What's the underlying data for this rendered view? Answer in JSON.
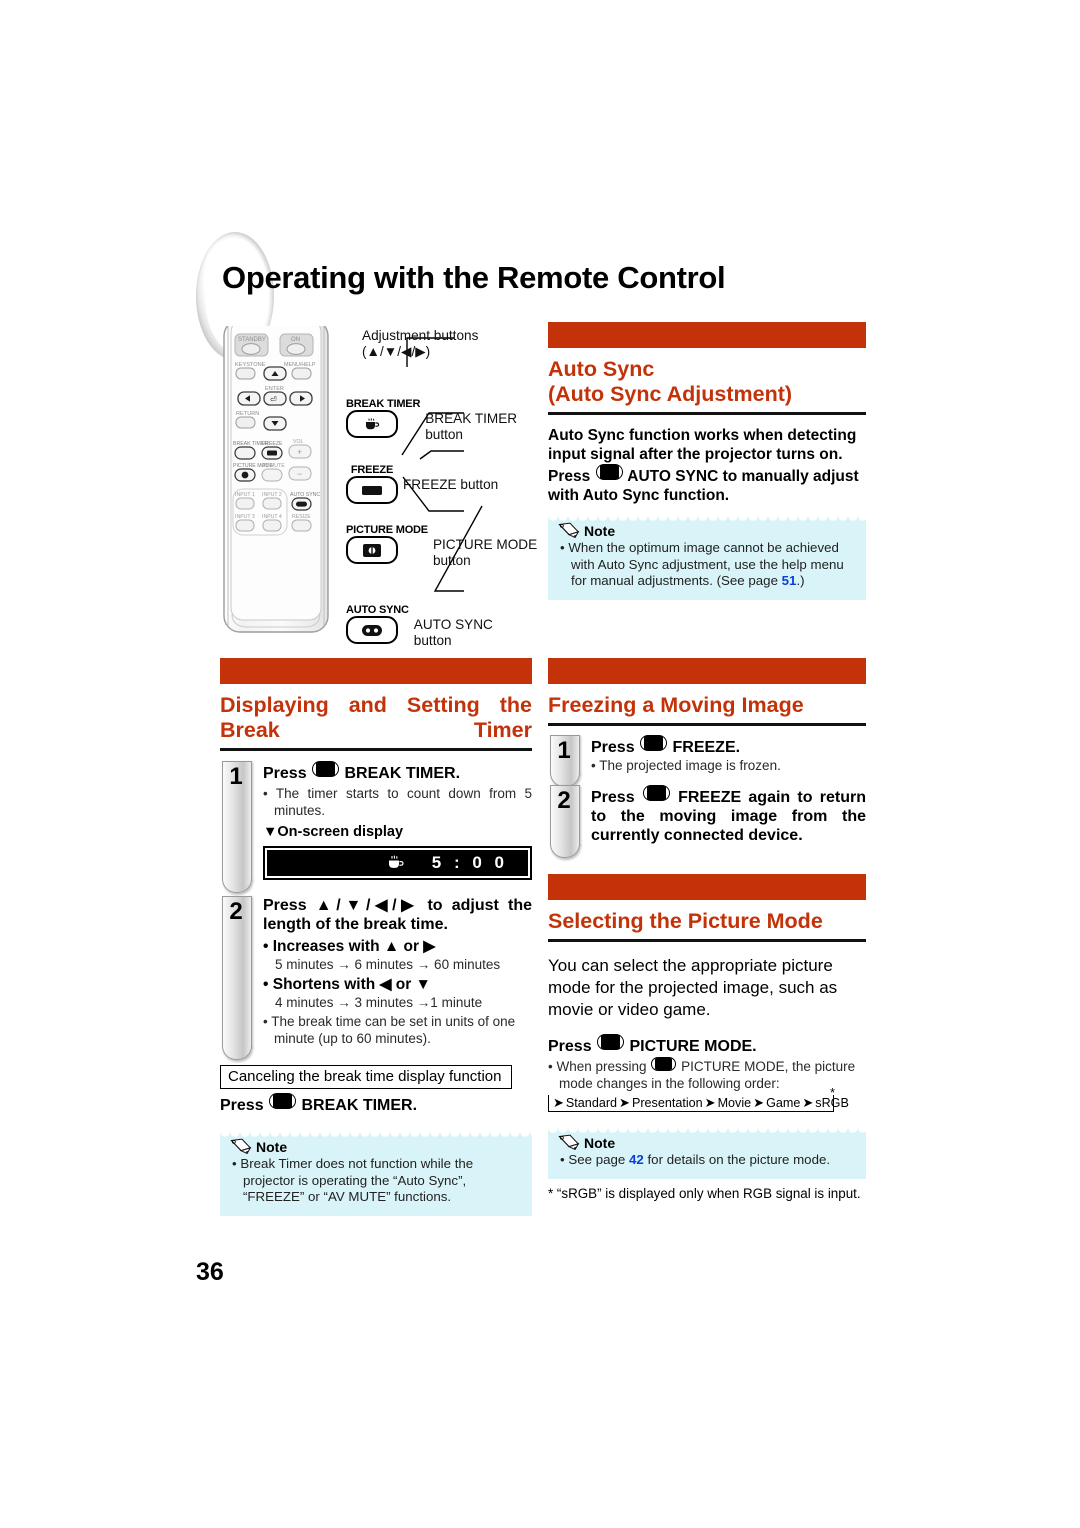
{
  "page": {
    "title": "Operating with the Remote Control",
    "number": "36"
  },
  "remote_diagram": {
    "callouts": [
      {
        "label": "Adjustment buttons",
        "label2": "(▲/▼/◀/▶)"
      },
      {
        "key_name": "BREAK TIMER",
        "label": "BREAK TIMER",
        "label2": "button"
      },
      {
        "key_name": "FREEZE",
        "label": "FREEZE button",
        "label2": ""
      },
      {
        "key_name": "PICTURE MODE",
        "label": "PICTURE MODE",
        "label2": "button"
      },
      {
        "key_name": "AUTO SYNC",
        "label": "AUTO SYNC",
        "label2": "button"
      }
    ],
    "remote_keys": [
      "STANDBY",
      "ON",
      "KEYSTONE",
      "MENU/HELP",
      "ENTER",
      "RETURN",
      "BREAK TIMER",
      "FREEZE",
      "VOL",
      "PICTURE MODE",
      "AV MUTE",
      "INPUT 1",
      "INPUT 2",
      "AUTO SYNC",
      "INPUT 3",
      "INPUT 4",
      "RESIZE"
    ]
  },
  "sections": {
    "auto_sync": {
      "heading_line1": "Auto Sync",
      "heading_line2": "(Auto Sync Adjustment)",
      "body": "Auto Sync function works when detecting input signal after the projector turns on.",
      "body2_pre": "Press",
      "body2_post": "AUTO SYNC to manually adjust with Auto Sync function.",
      "note_title": "Note",
      "note_items": [
        {
          "text_before": "When the optimum image cannot be achieved with Auto Sync adjustment, use the help menu for manual adjustments. (See page ",
          "page_ref": "51",
          "text_after": ".)"
        }
      ]
    },
    "break_timer": {
      "heading": "Displaying  and  Setting  the Break Timer",
      "step1": {
        "num": "1",
        "title_pre": "Press",
        "title_post": "BREAK TIMER.",
        "bullet": "The timer starts to count down from 5 minutes.",
        "osd_label": "▼On-screen display",
        "osd_time": "5 : 0 0"
      },
      "step2": {
        "num": "2",
        "title": "Press ▲/▼/◀/▶ to adjust the length of the break time.",
        "inc_label": "Increases with ▲ or ▶",
        "inc_detail": "5 minutes → 6 minutes → 60 minutes",
        "dec_label": "Shortens with ◀ or ▼",
        "dec_detail": "4 minutes → 3 minutes →1 minute",
        "bullet": "The break time can be set in units of one minute (up to 60 minutes)."
      },
      "cancel_box": "Canceling the break time display function",
      "cancel_pre": "Press",
      "cancel_post": "BREAK TIMER.",
      "note_title": "Note",
      "note_items": [
        {
          "text_before": "Break Timer does not function while the projector is operating the “Auto Sync”, “FREEZE” or “AV MUTE” functions.",
          "page_ref": "",
          "text_after": ""
        }
      ]
    },
    "freeze": {
      "heading": "Freezing a Moving Image",
      "step1": {
        "num": "1",
        "title_pre": "Press",
        "title_post": "FREEZE.",
        "bullet": "The projected image is frozen."
      },
      "step2": {
        "num": "2",
        "title_pre": "Press",
        "title_post": "FREEZE again to return to the moving image from the currently connected device."
      }
    },
    "picture_mode": {
      "heading": "Selecting the Picture Mode",
      "body": "You can select the appropriate picture mode for the projected image, such as movie or video game.",
      "press_pre": "Press",
      "press_post": "PICTURE MODE.",
      "bullet_pre": "When pressing",
      "bullet_post": "PICTURE MODE, the picture mode changes in the following order:",
      "flow": [
        "Standard",
        "Presentation",
        "Movie",
        "Game",
        "sRGB"
      ],
      "flow_star": "*",
      "note_title": "Note",
      "note_items": [
        {
          "text_before": "See page ",
          "page_ref": "42",
          "text_after": " for details on the picture mode."
        }
      ],
      "footnote": "* “sRGB” is displayed only when RGB signal is input."
    }
  },
  "colors": {
    "accent_orange": "#c33208",
    "note_bg": "#d9f4f8",
    "page_ref_blue": "#0b3fd6"
  }
}
